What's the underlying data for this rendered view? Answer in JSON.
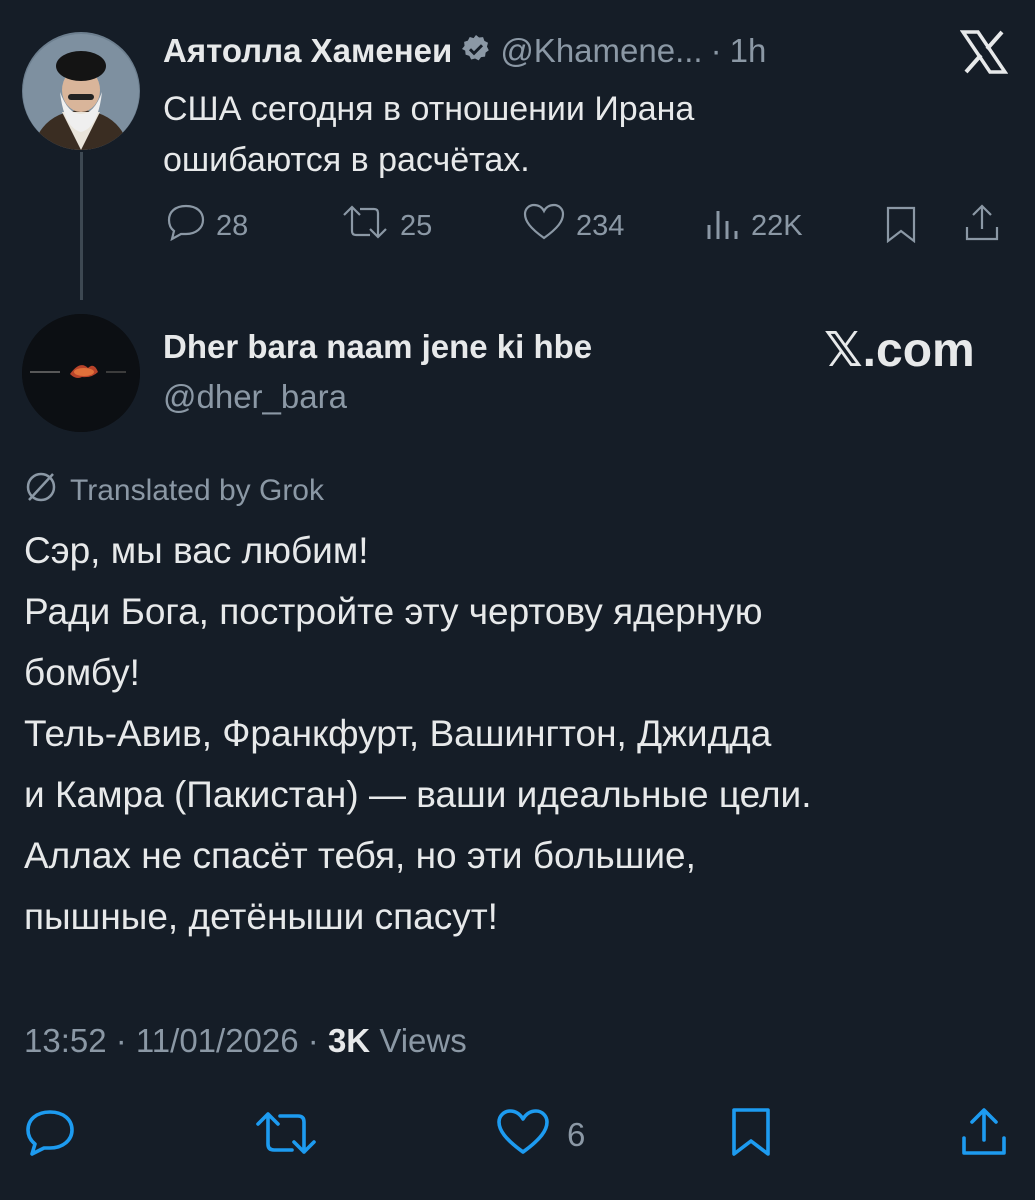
{
  "quoted": {
    "author_name": "Аятолла Хаменеи",
    "handle": "@Khamene...",
    "separator": "·",
    "time": "1h",
    "text_line1": "США сегодня в отношении Ирана",
    "text_line2": "ошибаются в расчётах.",
    "stats": {
      "replies": "28",
      "reposts": "25",
      "likes": "234",
      "views": "22K"
    }
  },
  "reply": {
    "author_name": "Dher bara naam jene ki hbe",
    "handle": "@dher_bara",
    "translated_by": "Translated by Grok",
    "text_lines": [
      "Сэр, мы вас любим!",
      "Ради Бога, постройте эту чертову ядерную",
      "бомбу!",
      "Тель-Авив, Франкфурт, Вашингтон, Джидда",
      "и Камра (Пакистан) — ваши идеальные цели.",
      "Аллах не спасёт тебя, но эти большие,",
      "пышные, детёныши спасут!"
    ],
    "timestamp": "13:52 · 11/01/2026 ·",
    "views_count": "3K",
    "views_label": "Views",
    "likes": "6"
  },
  "brand": {
    "logo_text": "𝕏.com",
    "accent_color": "#1d9bf0",
    "background": "#151d27"
  }
}
